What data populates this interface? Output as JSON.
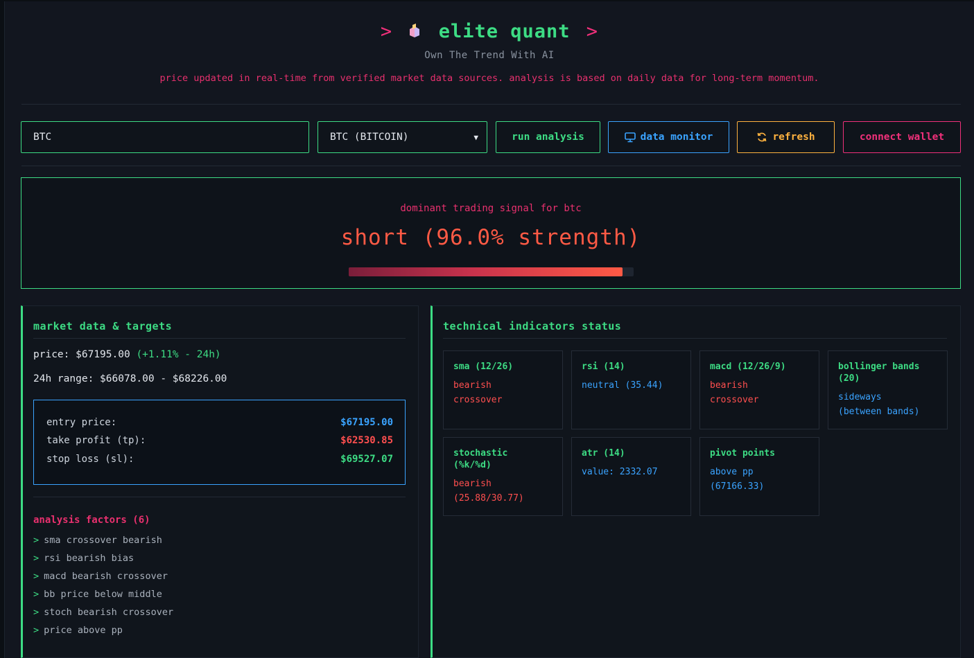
{
  "header": {
    "brand": "elite quant",
    "chevron_left": ">",
    "chevron_right": ">",
    "tagline": "Own The Trend With AI",
    "notice": "price updated in real-time from verified market data sources. analysis is based on daily data for long-term momentum."
  },
  "controls": {
    "symbol_value": "BTC",
    "select_value": "BTC (BITCOIN)",
    "run_label": "run analysis",
    "monitor_label": "data monitor",
    "refresh_label": "refresh",
    "wallet_label": "connect wallet"
  },
  "signal": {
    "label": "dominant trading signal for btc",
    "value": "short (96.0% strength)",
    "strength_pct": 96.0
  },
  "market": {
    "title": "market data & targets",
    "price_label": "price:",
    "price_value": "$67195.00",
    "price_change": "(+1.11% - 24h)",
    "range_label": "24h range:",
    "range_value": "$66078.00 - $68226.00",
    "entry_label": "entry price:",
    "entry_value": "$67195.00",
    "tp_label": "take profit (tp):",
    "tp_value": "$62530.85",
    "sl_label": "stop loss (sl):",
    "sl_value": "$69527.07"
  },
  "factors": {
    "title": "analysis factors (6)",
    "items": [
      "sma crossover bearish",
      "rsi bearish bias",
      "macd bearish crossover",
      "bb price below middle",
      "stoch bearish crossover",
      "price above pp"
    ]
  },
  "indicators": {
    "title": "technical indicators status",
    "items": [
      {
        "name": "sma (12/26)",
        "value": "bearish\ncrossover",
        "tone": "red"
      },
      {
        "name": "rsi (14)",
        "value": "neutral (35.44)",
        "tone": "blue"
      },
      {
        "name": "macd (12/26/9)",
        "value": "bearish\ncrossover",
        "tone": "red"
      },
      {
        "name": "bollinger bands\n(20)",
        "value": "sideways\n(between bands)",
        "tone": "blue"
      },
      {
        "name": "stochastic\n(%k/%d)",
        "value": "bearish\n(25.88/30.77)",
        "tone": "red"
      },
      {
        "name": "atr (14)",
        "value": "value: 2332.07",
        "tone": "blue"
      },
      {
        "name": "pivot points",
        "value": "above pp\n(67166.33)",
        "tone": "blue"
      }
    ]
  },
  "colors": {
    "accent_green": "#3ddc84",
    "accent_pink": "#e8306e",
    "accent_blue": "#3aa3ff",
    "accent_orange": "#ffb23f",
    "signal_red": "#ff5a45"
  }
}
